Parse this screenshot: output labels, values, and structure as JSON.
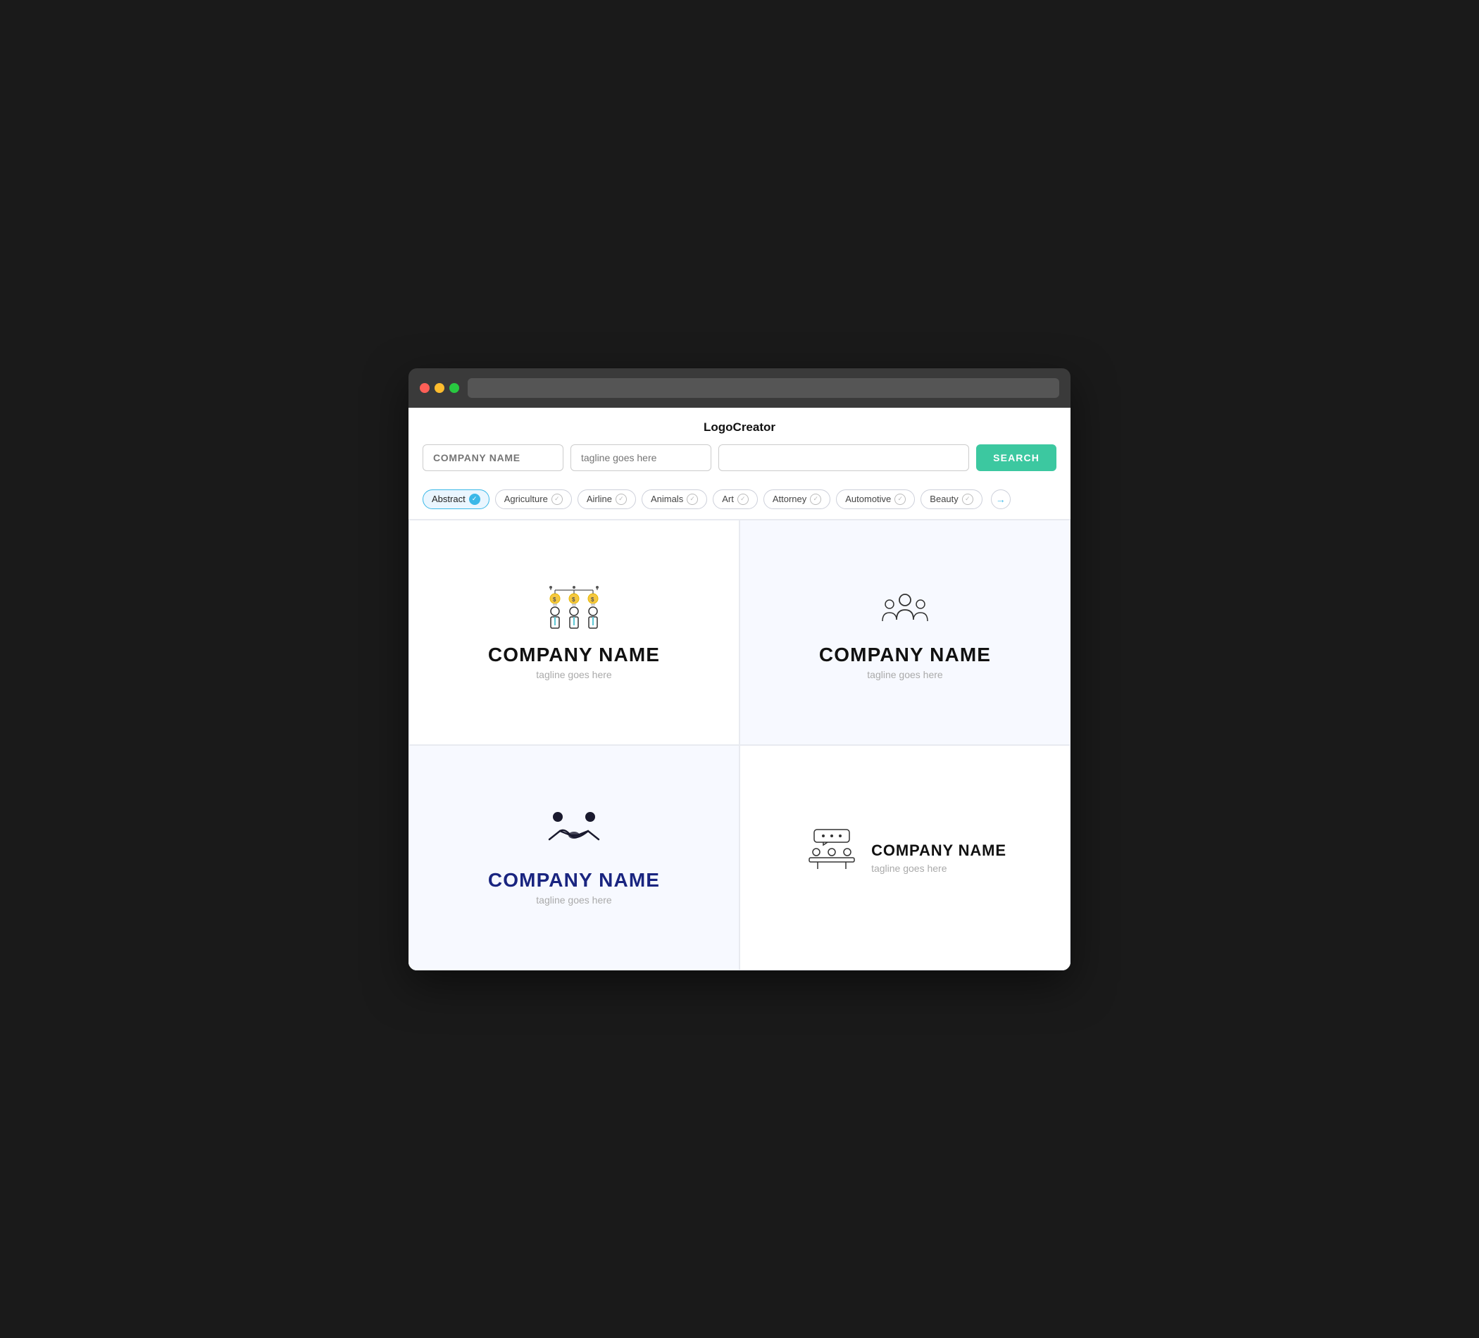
{
  "app": {
    "title": "LogoCreator"
  },
  "search": {
    "company_placeholder": "COMPANY NAME",
    "tagline_placeholder": "tagline goes here",
    "empty_placeholder": "",
    "button_label": "SEARCH"
  },
  "filters": [
    {
      "label": "Abstract",
      "active": true
    },
    {
      "label": "Agriculture",
      "active": false
    },
    {
      "label": "Airline",
      "active": false
    },
    {
      "label": "Animals",
      "active": false
    },
    {
      "label": "Art",
      "active": false
    },
    {
      "label": "Attorney",
      "active": false
    },
    {
      "label": "Automotive",
      "active": false
    },
    {
      "label": "Beauty",
      "active": false
    }
  ],
  "logos": [
    {
      "id": 1,
      "company": "COMPANY NAME",
      "tagline": "tagline goes here",
      "style": "normal",
      "color": "#111111",
      "icon": "investment"
    },
    {
      "id": 2,
      "company": "COMPANY NAME",
      "tagline": "tagline goes here",
      "style": "normal",
      "color": "#111111",
      "icon": "team"
    },
    {
      "id": 3,
      "company": "COMPANY NAME",
      "tagline": "tagline goes here",
      "style": "bold",
      "color": "#1a2580",
      "icon": "handshake"
    },
    {
      "id": 4,
      "company": "COMPANY NAME",
      "tagline": "tagline goes here",
      "style": "inline",
      "color": "#111111",
      "icon": "meeting"
    }
  ]
}
